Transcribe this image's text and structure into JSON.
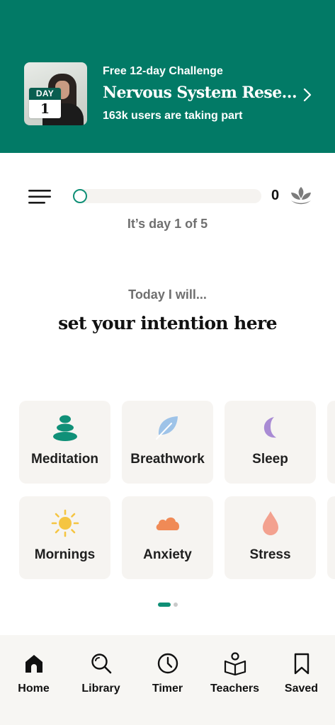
{
  "banner": {
    "day_badge_label": "DAY",
    "day_badge_number": "1",
    "subtitle": "Free 12-day Challenge",
    "title": "Nervous System Reset Challenge",
    "participants": "163k users are taking part"
  },
  "progress": {
    "points": "0",
    "fraction": 0,
    "day_status": "It’s day 1 of 5"
  },
  "intention": {
    "label": "Today I will...",
    "text": "set your intention here"
  },
  "categories": [
    {
      "label": "Meditation",
      "icon": "stones-icon",
      "color": "#109078"
    },
    {
      "label": "Breathwork",
      "icon": "leaf-icon",
      "color": "#9ec3e8"
    },
    {
      "label": "Sleep",
      "icon": "moon-icon",
      "color": "#a98bd4"
    },
    {
      "label": "Mornings",
      "icon": "sun-icon",
      "color": "#f5c542"
    },
    {
      "label": "Anxiety",
      "icon": "cloud-icon",
      "color": "#f08a56"
    },
    {
      "label": "Stress",
      "icon": "drop-icon",
      "color": "#f3a18f"
    }
  ],
  "pagination": {
    "pages": 2,
    "current": 1
  },
  "nav": [
    {
      "label": "Home",
      "icon": "home-icon",
      "active": true
    },
    {
      "label": "Library",
      "icon": "search-icon",
      "active": false
    },
    {
      "label": "Timer",
      "icon": "clock-icon",
      "active": false
    },
    {
      "label": "Teachers",
      "icon": "book-reader-icon",
      "active": false
    },
    {
      "label": "Saved",
      "icon": "bookmark-icon",
      "active": false
    }
  ],
  "colors": {
    "brand_green": "#027a66",
    "accent": "#0f8f76",
    "card_bg": "#f6f4f1",
    "nav_bg": "#f7f6f3"
  }
}
